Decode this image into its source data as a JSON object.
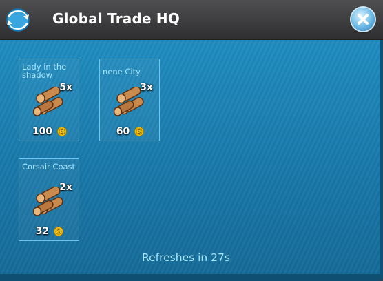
{
  "header": {
    "title": "Global Trade HQ",
    "logo_icon": "globe-arrows-icon",
    "close_icon": "close-icon"
  },
  "offers": [
    {
      "city": "Lady in the shadow",
      "quantity": "5x",
      "price": "100",
      "item_icon": "wood-logs-icon",
      "currency_icon": "simoleon-coin-icon"
    },
    {
      "city": "nene City",
      "quantity": "3x",
      "price": "60",
      "item_icon": "wood-logs-icon",
      "currency_icon": "simoleon-coin-icon"
    },
    {
      "city": "Corsair Coast",
      "quantity": "2x",
      "price": "32",
      "item_icon": "wood-logs-icon",
      "currency_icon": "simoleon-coin-icon"
    }
  ],
  "footer": {
    "refresh_text": "Refreshes in 27s"
  },
  "colors": {
    "panel": "#1877a8",
    "accent_text": "#a9e6ff",
    "header": "#3a3a3c"
  }
}
